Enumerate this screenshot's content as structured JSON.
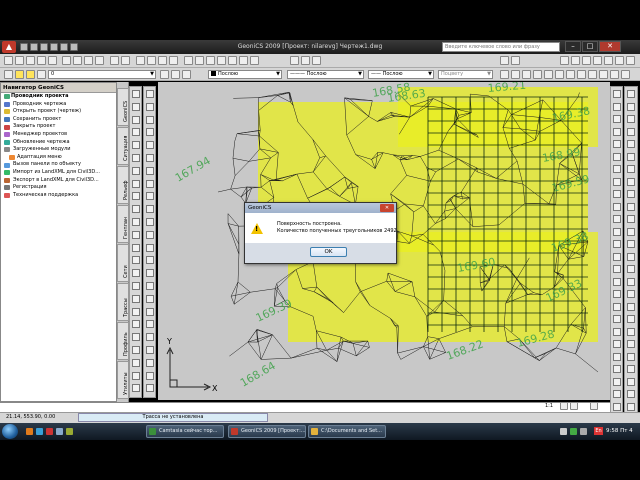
{
  "app": {
    "title": "GeoniCS 2009 [Проект: nilarevg] Чертеж1.dwg",
    "search_placeholder": "Введите ключевое слово или фразу",
    "accent": "#c0392b"
  },
  "toolbar": {
    "layer_value": "0",
    "color_value": "Послою",
    "linetype_value": "Послою",
    "lineweight_value": "Послою",
    "plotstyle_value": "Поцвету"
  },
  "navigator": {
    "title": "Навигатор GeoniCS",
    "items": [
      {
        "label": "Проводник проекта",
        "root": true,
        "icon": "project-explorer-icon",
        "color": "#4a7"
      },
      {
        "label": "Проводник чертежа",
        "icon": "drawing-explorer-icon",
        "color": "#57c"
      },
      {
        "label": "Открыть проект (чертеж)",
        "icon": "open-project-icon",
        "color": "#db3"
      },
      {
        "label": "Сохранить проект",
        "icon": "save-project-icon",
        "color": "#47b"
      },
      {
        "label": "Закрыть проект",
        "icon": "close-project-icon",
        "color": "#c44"
      },
      {
        "label": "Менеджер проектов",
        "icon": "project-manager-icon",
        "color": "#a6c"
      },
      {
        "label": "Обновление чертежа",
        "icon": "refresh-drawing-icon",
        "color": "#3a9"
      },
      {
        "label": "Загруженные модули",
        "icon": "modules-icon",
        "color": "#888"
      },
      {
        "label": "Адаптация меню",
        "child": true,
        "icon": "menu-adapt-icon",
        "color": "#e83"
      },
      {
        "label": "Вызов панели по объекту",
        "icon": "object-panel-icon",
        "color": "#59d"
      },
      {
        "label": "Импорт из LandXML для Civil3D...",
        "icon": "import-landxml-icon",
        "color": "#3b6"
      },
      {
        "label": "Экспорт в LandXML для Civil3D...",
        "icon": "export-landxml-icon",
        "color": "#b63"
      },
      {
        "label": "Регистрация",
        "icon": "registration-icon",
        "color": "#777"
      },
      {
        "label": "Техническая поддержка",
        "icon": "support-icon",
        "color": "#d55"
      }
    ]
  },
  "vtabs": [
    "Утилиты",
    "Профиль",
    "Трассы",
    "Сети",
    "Генплан",
    "Рельеф",
    "Ситуация",
    "GeoniCS"
  ],
  "drawing": {
    "elevation_labels": [
      "168.58",
      "169.21",
      "167.94",
      "168.63",
      "169.38",
      "168.99",
      "169.59",
      "169.38",
      "169.33",
      "169.60",
      "168.64",
      "169.39",
      "168.22",
      "169.28"
    ],
    "axis_x": "X",
    "axis_y": "Y",
    "bg": "#c8c8c8",
    "tin_color": "#1a1a1a",
    "highlight_color": "#e9ef1f",
    "text_color": "#3fa24a"
  },
  "dialog": {
    "title": "GeoniCS",
    "line1": "Поверхность построена.",
    "line2": "Количество полученных треугольников 2492.",
    "ok": "OK"
  },
  "statusbar": {
    "coords": "21.14, 553.90, 0.00",
    "route_status": "Трасса не установлена",
    "scale": "1:1"
  },
  "taskbar": {
    "tasks": [
      {
        "label": "Camtasia сейчас тор...",
        "icon": "camtasia-icon",
        "color": "#3b8f3b"
      },
      {
        "label": "GeoniCS 2009 [Проект:...",
        "icon": "geonics-icon",
        "color": "#c0392b"
      },
      {
        "label": "C:\\Documents and Set...",
        "icon": "folder-icon",
        "color": "#e3b13c"
      }
    ],
    "lang": "En",
    "time": "9:58 Пт 4"
  }
}
